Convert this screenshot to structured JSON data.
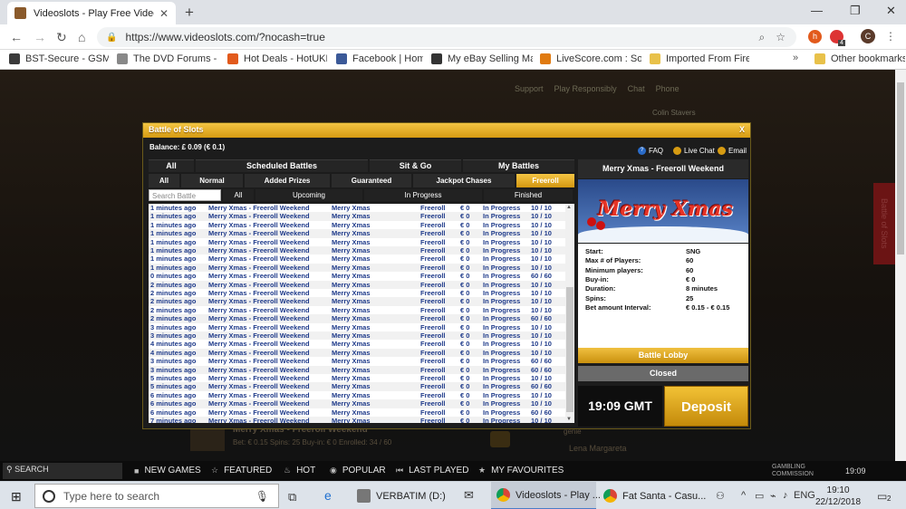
{
  "browser": {
    "tab_title": "Videoslots - Play Free Video Slo",
    "url": "https://www.videoslots.com/?nocash=true",
    "ext_badge": "4",
    "profile_initial": "C"
  },
  "bookmarks": [
    {
      "label": "BST-Secure - GSM-C",
      "color": "#3a3a3a"
    },
    {
      "label": "The DVD Forums - pc",
      "color": "#888"
    },
    {
      "label": "Hot Deals - HotUKDe",
      "color": "#e25a1c"
    },
    {
      "label": "Facebook | Home",
      "color": "#3b5998"
    },
    {
      "label": "My eBay Selling Man",
      "color": "#333"
    },
    {
      "label": "LiveScore.com : Socc",
      "color": "#e07a10"
    },
    {
      "label": "Imported From Firefo",
      "color": "#e8c14a"
    }
  ],
  "bookmarks_other": "Other bookmarks",
  "site": {
    "top_links": [
      "Support",
      "Play Responsibly",
      "Chat",
      "Phone"
    ],
    "username": "Colin Stavers",
    "side_tab": "Battle of Slots",
    "strip_game": "Merry Xmas - Freeroll Weekend",
    "strip_details": "Bet: € 0.15   Spins: 25   Buy-in: € 0   Enrolled: 34 / 60",
    "strip_user": "Lena Margareta",
    "strip_user2": "genie"
  },
  "modal": {
    "title": "Battle of Slots",
    "close": "X",
    "balance": "Balance: £ 0.09 (€ 0.1)",
    "help_links": [
      "FAQ",
      "Live Chat",
      "Email"
    ],
    "tabs_row1": [
      "All",
      "Scheduled Battles",
      "Sit & Go",
      "My Battles"
    ],
    "tabs_row2": [
      "All",
      "Normal",
      "Added Prizes",
      "Guaranteed",
      "Jackpot Chases",
      "Freeroll"
    ],
    "filter_placeholder": "Search Battle",
    "tabs_row3": [
      "All",
      "Upcoming",
      "In Progress",
      "Finished"
    ],
    "rows": [
      {
        "time": "1 minutes ago",
        "name": "Merry Xmas - Freeroll Weekend",
        "game": "Merry Xmas",
        "type": "Freeroll",
        "buyin": "€ 0",
        "status": "In Progress",
        "players": "10 / 10"
      },
      {
        "time": "1 minutes ago",
        "name": "Merry Xmas - Freeroll Weekend",
        "game": "Merry Xmas",
        "type": "Freeroll",
        "buyin": "€ 0",
        "status": "In Progress",
        "players": "10 / 10"
      },
      {
        "time": "1 minutes ago",
        "name": "Merry Xmas - Freeroll Weekend",
        "game": "Merry Xmas",
        "type": "Freeroll",
        "buyin": "€ 0",
        "status": "In Progress",
        "players": "10 / 10"
      },
      {
        "time": "1 minutes ago",
        "name": "Merry Xmas - Freeroll Weekend",
        "game": "Merry Xmas",
        "type": "Freeroll",
        "buyin": "€ 0",
        "status": "In Progress",
        "players": "10 / 10"
      },
      {
        "time": "1 minutes ago",
        "name": "Merry Xmas - Freeroll Weekend",
        "game": "Merry Xmas",
        "type": "Freeroll",
        "buyin": "€ 0",
        "status": "In Progress",
        "players": "10 / 10"
      },
      {
        "time": "1 minutes ago",
        "name": "Merry Xmas - Freeroll Weekend",
        "game": "Merry Xmas",
        "type": "Freeroll",
        "buyin": "€ 0",
        "status": "In Progress",
        "players": "10 / 10"
      },
      {
        "time": "1 minutes ago",
        "name": "Merry Xmas - Freeroll Weekend",
        "game": "Merry Xmas",
        "type": "Freeroll",
        "buyin": "€ 0",
        "status": "In Progress",
        "players": "10 / 10"
      },
      {
        "time": "1 minutes ago",
        "name": "Merry Xmas - Freeroll Weekend",
        "game": "Merry Xmas",
        "type": "Freeroll",
        "buyin": "€ 0",
        "status": "In Progress",
        "players": "10 / 10"
      },
      {
        "time": "0 minutes ago",
        "name": "Merry Xmas - Freeroll Weekend",
        "game": "Merry Xmas",
        "type": "Freeroll",
        "buyin": "€ 0",
        "status": "In Progress",
        "players": "60 / 60"
      },
      {
        "time": "2 minutes ago",
        "name": "Merry Xmas - Freeroll Weekend",
        "game": "Merry Xmas",
        "type": "Freeroll",
        "buyin": "€ 0",
        "status": "In Progress",
        "players": "10 / 10"
      },
      {
        "time": "2 minutes ago",
        "name": "Merry Xmas - Freeroll Weekend",
        "game": "Merry Xmas",
        "type": "Freeroll",
        "buyin": "€ 0",
        "status": "In Progress",
        "players": "10 / 10"
      },
      {
        "time": "2 minutes ago",
        "name": "Merry Xmas - Freeroll Weekend",
        "game": "Merry Xmas",
        "type": "Freeroll",
        "buyin": "€ 0",
        "status": "In Progress",
        "players": "10 / 10"
      },
      {
        "time": "2 minutes ago",
        "name": "Merry Xmas - Freeroll Weekend",
        "game": "Merry Xmas",
        "type": "Freeroll",
        "buyin": "€ 0",
        "status": "In Progress",
        "players": "10 / 10"
      },
      {
        "time": "2 minutes ago",
        "name": "Merry Xmas - Freeroll Weekend",
        "game": "Merry Xmas",
        "type": "Freeroll",
        "buyin": "€ 0",
        "status": "In Progress",
        "players": "60 / 60"
      },
      {
        "time": "3 minutes ago",
        "name": "Merry Xmas - Freeroll Weekend",
        "game": "Merry Xmas",
        "type": "Freeroll",
        "buyin": "€ 0",
        "status": "In Progress",
        "players": "10 / 10"
      },
      {
        "time": "3 minutes ago",
        "name": "Merry Xmas - Freeroll Weekend",
        "game": "Merry Xmas",
        "type": "Freeroll",
        "buyin": "€ 0",
        "status": "In Progress",
        "players": "10 / 10"
      },
      {
        "time": "4 minutes ago",
        "name": "Merry Xmas - Freeroll Weekend",
        "game": "Merry Xmas",
        "type": "Freeroll",
        "buyin": "€ 0",
        "status": "In Progress",
        "players": "10 / 10"
      },
      {
        "time": "4 minutes ago",
        "name": "Merry Xmas - Freeroll Weekend",
        "game": "Merry Xmas",
        "type": "Freeroll",
        "buyin": "€ 0",
        "status": "In Progress",
        "players": "10 / 10"
      },
      {
        "time": "3 minutes ago",
        "name": "Merry Xmas - Freeroll Weekend",
        "game": "Merry Xmas",
        "type": "Freeroll",
        "buyin": "€ 0",
        "status": "In Progress",
        "players": "60 / 60"
      },
      {
        "time": "3 minutes ago",
        "name": "Merry Xmas - Freeroll Weekend",
        "game": "Merry Xmas",
        "type": "Freeroll",
        "buyin": "€ 0",
        "status": "In Progress",
        "players": "60 / 60"
      },
      {
        "time": "5 minutes ago",
        "name": "Merry Xmas - Freeroll Weekend",
        "game": "Merry Xmas",
        "type": "Freeroll",
        "buyin": "€ 0",
        "status": "In Progress",
        "players": "10 / 10"
      },
      {
        "time": "5 minutes ago",
        "name": "Merry Xmas - Freeroll Weekend",
        "game": "Merry Xmas",
        "type": "Freeroll",
        "buyin": "€ 0",
        "status": "In Progress",
        "players": "60 / 60"
      },
      {
        "time": "6 minutes ago",
        "name": "Merry Xmas - Freeroll Weekend",
        "game": "Merry Xmas",
        "type": "Freeroll",
        "buyin": "€ 0",
        "status": "In Progress",
        "players": "10 / 10"
      },
      {
        "time": "6 minutes ago",
        "name": "Merry Xmas - Freeroll Weekend",
        "game": "Merry Xmas",
        "type": "Freeroll",
        "buyin": "€ 0",
        "status": "In Progress",
        "players": "10 / 10"
      },
      {
        "time": "6 minutes ago",
        "name": "Merry Xmas - Freeroll Weekend",
        "game": "Merry Xmas",
        "type": "Freeroll",
        "buyin": "€ 0",
        "status": "In Progress",
        "players": "60 / 60"
      },
      {
        "time": "7 minutes ago",
        "name": "Merry Xmas - Freeroll Weekend",
        "game": "Merry Xmas",
        "type": "Freeroll",
        "buyin": "€ 0",
        "status": "In Progress",
        "players": "10 / 10"
      }
    ],
    "detail": {
      "title": "Merry Xmas - Freeroll Weekend",
      "banner_text": "Merry Xmas",
      "fields": [
        {
          "label": "Start:",
          "value": "SNG"
        },
        {
          "label": "Max # of Players:",
          "value": "60"
        },
        {
          "label": "Minimum players:",
          "value": "60"
        },
        {
          "label": "Buy-in:",
          "value": "€ 0"
        },
        {
          "label": "Duration:",
          "value": "8 minutes"
        },
        {
          "label": "Spins:",
          "value": "25"
        },
        {
          "label": "Bet amount Interval:",
          "value": "€ 0.15 - € 0.15"
        }
      ],
      "lobby_button": "Battle Lobby",
      "closed_button": "Closed"
    },
    "clock": "19:09  GMT",
    "deposit": "Deposit"
  },
  "sitebar": {
    "search": "SEARCH",
    "items": [
      "NEW GAMES",
      "FEATURED",
      "HOT",
      "POPULAR",
      "LAST PLAYED",
      "MY FAVOURITES"
    ],
    "gambling": "GAMBLING COMMISSION",
    "time": "19:09"
  },
  "taskbar": {
    "search_placeholder": "Type here to search",
    "items": [
      {
        "label": "VERBATIM (D:)",
        "active": false
      },
      {
        "label": "Videoslots - Play ...",
        "active": true
      },
      {
        "label": "Fat Santa - Casu...",
        "active": false
      }
    ],
    "lang": "ENG",
    "time": "19:10",
    "date": "22/12/2018",
    "notif_count": "2"
  }
}
